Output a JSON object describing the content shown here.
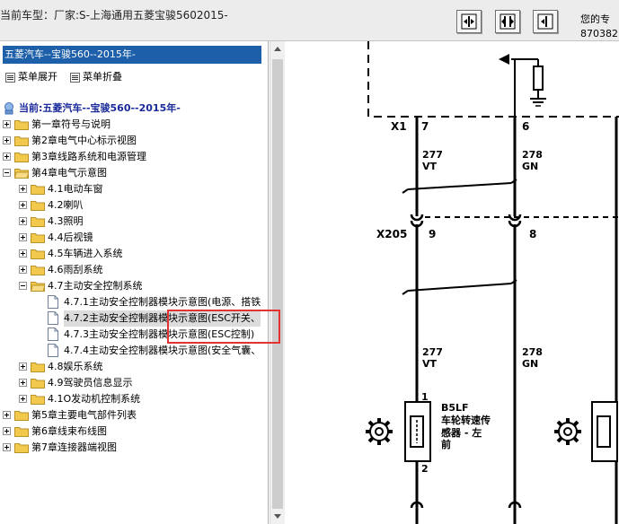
{
  "header": {
    "title": "当前车型：厂家:S-上海通用五菱宝骏5602015-",
    "buttons": [
      {
        "name": "fit-width-button",
        "icon": "fit-width-icon"
      },
      {
        "name": "fit-both-button",
        "icon": "fit-both-icon"
      },
      {
        "name": "fit-page-button",
        "icon": "fit-page-icon"
      }
    ],
    "right_line1": "您的专",
    "right_line2": "870382"
  },
  "sidebar": {
    "model_bar": "五菱汽车--宝骏560--2015年-",
    "expand_label": "菜单展开",
    "collapse_label": "菜单折叠",
    "root_label": "当前:五菱汽车--宝骏560--2015年-",
    "tree": [
      {
        "label": "第一章符号与说明"
      },
      {
        "label": "第2章电气中心标示视图"
      },
      {
        "label": "第3章线路系统和电源管理"
      },
      {
        "label": "第4章电气示意图"
      },
      {
        "label": "4.1电动车窗"
      },
      {
        "label": "4.2喇叭"
      },
      {
        "label": "4.3照明"
      },
      {
        "label": "4.4后视镜"
      },
      {
        "label": "4.5车辆进入系统"
      },
      {
        "label": "4.6雨刮系统"
      },
      {
        "label": "4.7主动安全控制系统"
      },
      {
        "label": "4.7.1主动安全控制器模块示意图(电源、搭铁"
      },
      {
        "label": "4.7.2主动安全控制器模块示意图(ESC开关、"
      },
      {
        "label": "4.7.3主动安全控制器模块示意图(ESC控制)"
      },
      {
        "label": "4.7.4主动安全控制器模块示意图(安全气囊、"
      },
      {
        "label": "4.8娱乐系统"
      },
      {
        "label": "4.9驾驶员信息显示"
      },
      {
        "label": "4.1O发动机控制系统"
      },
      {
        "label": "第5章主要电气部件列表"
      },
      {
        "label": "第6章线束布线图"
      },
      {
        "label": "第7章连接器端视图"
      }
    ]
  },
  "diagram": {
    "connector_x1": "X1",
    "connector_x205": "X205",
    "pin_x1_left": "7",
    "pin_x1_right": "6",
    "pin_x205_left": "9",
    "pin_x205_right": "8",
    "wire_left_num_top": "277",
    "wire_left_color_top": "VT",
    "wire_right_num_top": "278",
    "wire_right_color_top": "GN",
    "wire_left_num_bottom": "277",
    "wire_left_color_bottom": "VT",
    "wire_right_num_bottom": "278",
    "wire_right_color_bottom": "GN",
    "sensor_pin_top": "1",
    "sensor_pin_bottom": "2",
    "sensor_code": "B5LF",
    "sensor_name_1": "车轮转速传",
    "sensor_name_2": "感器 - 左",
    "sensor_name_3": "前"
  },
  "colors": {
    "model_bar": "#1d5fa8",
    "root_label": "#1a2a9a",
    "highlight_border": "#e23232",
    "folder": "#f2c94c"
  }
}
